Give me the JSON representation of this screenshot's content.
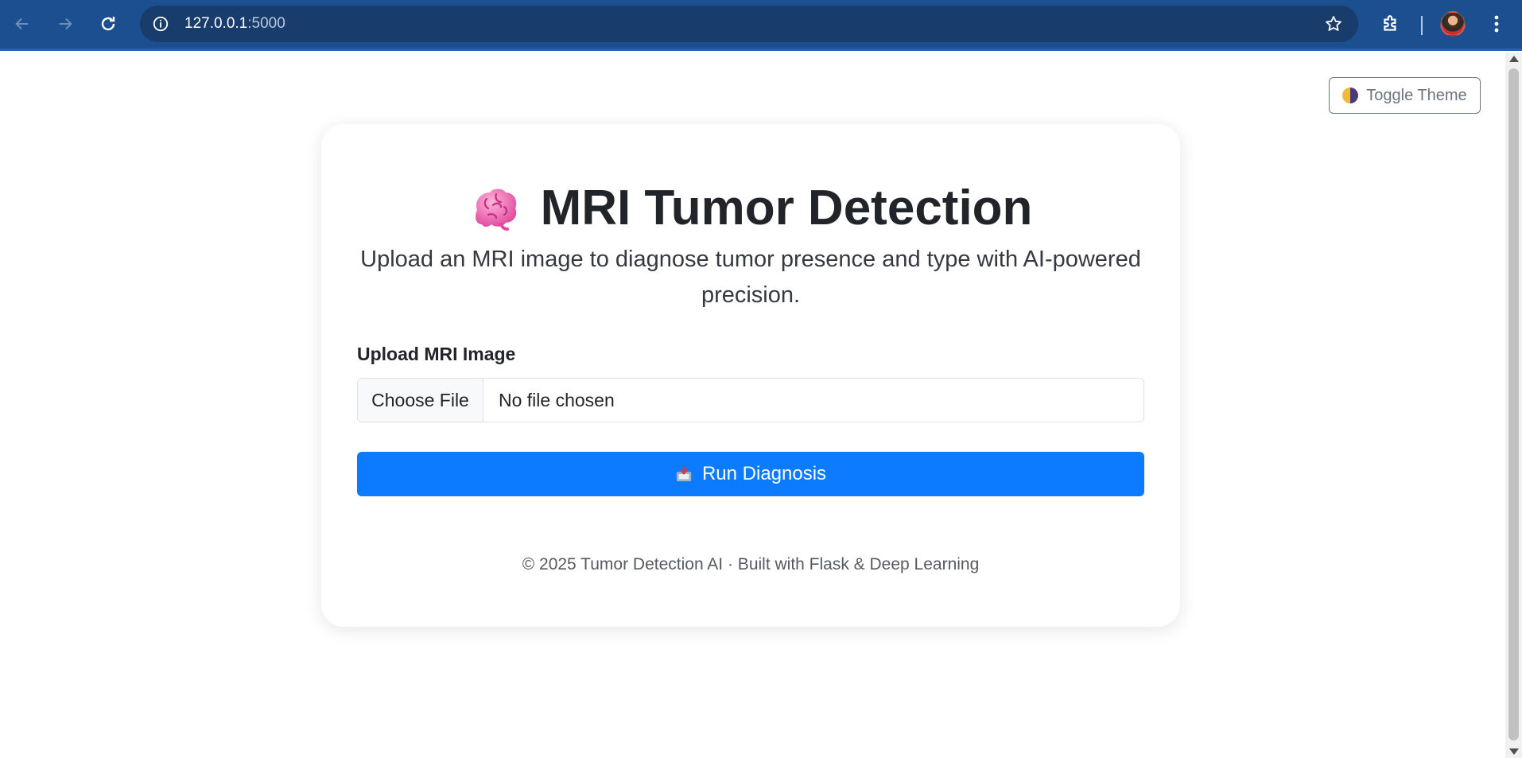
{
  "browser": {
    "url_host": "127.0.0.1",
    "url_port": ":5000",
    "icons": [
      "back-arrow-icon",
      "forward-arrow-icon",
      "reload-icon",
      "site-info-icon",
      "bookmark-star-icon",
      "extensions-icon",
      "profile-avatar",
      "kebab-menu-icon"
    ]
  },
  "page": {
    "toggle_theme_label": "Toggle Theme",
    "title": "MRI Tumor Detection",
    "subtitle": "Upload an MRI image to diagnose tumor presence and type with AI-powered precision.",
    "upload_label": "Upload MRI Image",
    "choose_file_label": "Choose File",
    "file_status": "No file chosen",
    "run_button_label": "Run Diagnosis",
    "footer": "© 2025 Tumor Detection AI · Built with Flask & Deep Learning"
  },
  "colors": {
    "browser_bar": "#1c4f8f",
    "primary_button": "#0d7bff",
    "toggle_border": "#6c757d"
  }
}
